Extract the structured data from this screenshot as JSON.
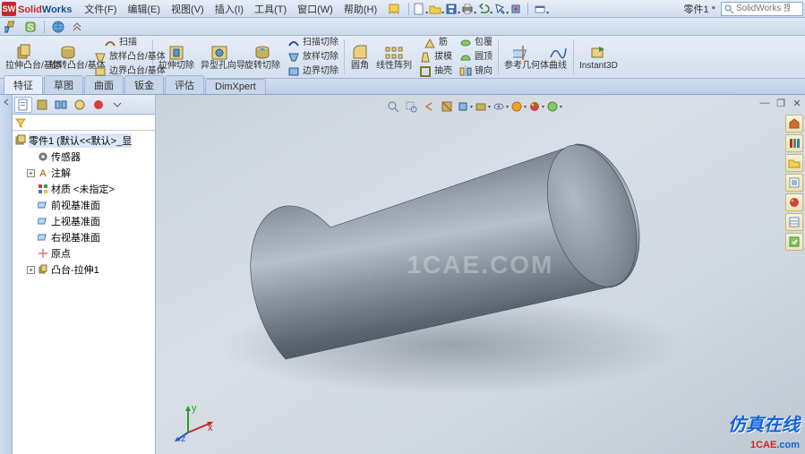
{
  "brand_solid": "Solid",
  "brand_works": "Works",
  "menus": [
    "文件(F)",
    "编辑(E)",
    "视图(V)",
    "插入(I)",
    "工具(T)",
    "窗口(W)",
    "帮助(H)"
  ],
  "doc_title": "零件1 *",
  "search_placeholder": "SolidWorks 搜索",
  "ribbon": {
    "extrude": "拉伸凸台/基体",
    "revolve": "旋转凸台/基体",
    "sweep": "扫描",
    "loft": "放样凸台/基体",
    "boundary": "边界凸台/基体",
    "cut_extrude": "拉伸切除",
    "hole": "异型孔向导",
    "cut_revolve": "旋转切除",
    "cut_sweep": "扫描切除",
    "cut_loft": "放样切除",
    "cut_boundary": "边界切除",
    "fillet": "圆角",
    "pattern": "线性阵列",
    "rib": "筋",
    "draft": "拔模",
    "shell": "抽壳",
    "wrap": "包覆",
    "dome": "圆顶",
    "mirror": "镜向",
    "geom": "参考几何体",
    "curve": "曲线",
    "instant": "Instant3D"
  },
  "tabs": [
    "特征",
    "草图",
    "曲面",
    "钣金",
    "评估",
    "DimXpert"
  ],
  "tree": {
    "root": "零件1 (默认<<默认>_显",
    "items": [
      "传感器",
      "注解",
      "材质 <未指定>",
      "前视基准面",
      "上视基准面",
      "右视基准面",
      "原点",
      "凸台-拉伸1"
    ]
  },
  "watermark": "1CAE.COM",
  "footer_cn": "仿真在线",
  "footer_url_1": "1CAE",
  "footer_url_2": ".com"
}
